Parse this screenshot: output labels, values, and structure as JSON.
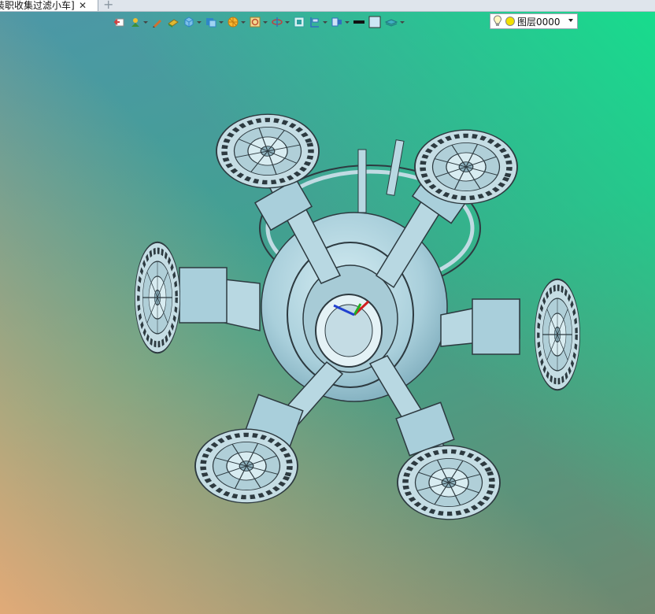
{
  "document_tab": {
    "label": "装职收集过滤小车]"
  },
  "toolbar": {
    "buttons": [
      {
        "name": "exit-sketch-icon",
        "color": "#d04040",
        "dropdown": false
      },
      {
        "name": "point-icon",
        "color": "#3b8f3b",
        "dropdown": true
      },
      {
        "name": "pencil-icon",
        "color": "#d07030",
        "dropdown": false
      },
      {
        "name": "eraser-icon",
        "color": "#e0b830",
        "dropdown": false
      },
      {
        "name": "box-view-icon",
        "color": "#2f86c8",
        "dropdown": true
      },
      {
        "name": "section-view-icon",
        "color": "#2f86c8",
        "dropdown": true
      },
      {
        "name": "render-style-icon",
        "color": "#f0a020",
        "dropdown": true
      },
      {
        "name": "zoom-icon",
        "color": "#e0a020",
        "dropdown": true
      },
      {
        "name": "rotate-icon",
        "color": "#c04040",
        "dropdown": true
      },
      {
        "name": "fit-view-icon",
        "color": "#2fa0a0",
        "dropdown": false
      },
      {
        "name": "dimension-icon",
        "color": "#3070c0",
        "dropdown": true
      },
      {
        "name": "display-mode-icon",
        "color": "#3070c0",
        "dropdown": true
      },
      {
        "name": "line-color-icon",
        "color": "#111111",
        "dropdown": false
      },
      {
        "name": "face-color-icon",
        "color": "#cce6f4",
        "dropdown": false
      },
      {
        "name": "layer-stack-icon",
        "color": "#40b0c0",
        "dropdown": true
      }
    ]
  },
  "layer": {
    "label": "图层0000",
    "bulb_color": "#f2e000"
  },
  "model": {
    "name": "spherical-robot-model",
    "part_color": "#b8d8e2",
    "edge_color": "#2d3a40"
  }
}
